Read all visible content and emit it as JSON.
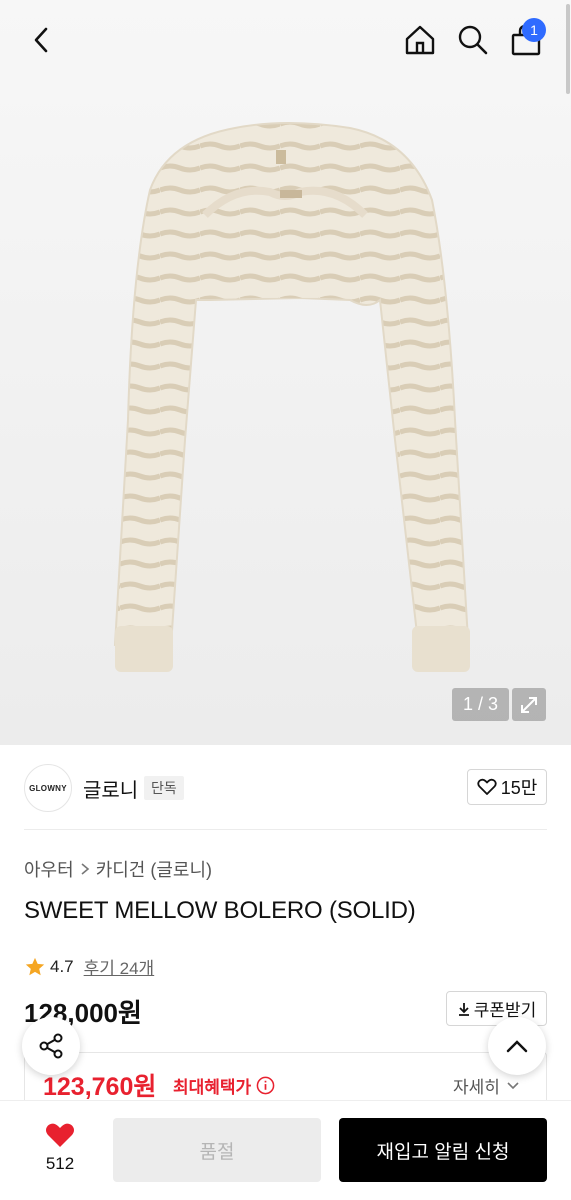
{
  "header": {
    "back_icon": "chevron-left-icon",
    "home_icon": "home-icon",
    "search_icon": "search-icon",
    "cart_icon": "shopping-bag-icon",
    "cart_count": "1",
    "badge_color": "#2f6bff"
  },
  "gallery": {
    "pager": "1 / 3",
    "expand_icon": "expand-icon"
  },
  "brand": {
    "logo_text": "GLOWNY",
    "name": "글로니",
    "badge": "단독",
    "like_count": "15만"
  },
  "product": {
    "breadcrumb": [
      "아우터",
      "카디건 (글로니)"
    ],
    "title": "SWEET MELLOW BOLERO (SOLID)",
    "rating": "4.7",
    "reviews": "후기 24개",
    "price": "128,000원",
    "coupon_label": "쿠폰받기"
  },
  "benefit": {
    "price": "123,760원",
    "label": "최대혜택가",
    "detail": "자세히",
    "color": "#e8212f"
  },
  "bottom": {
    "wish_count": "512",
    "soldout_label": "품절",
    "restock_label": "재입고 알림 신청"
  }
}
